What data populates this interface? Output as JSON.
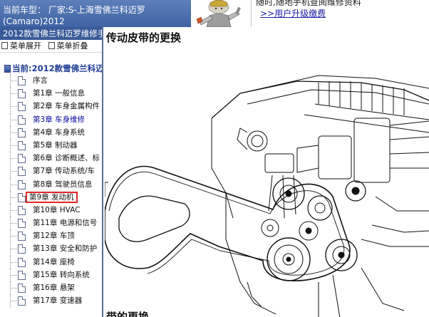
{
  "top_bar": {
    "car_info_line1": "当前车型： 厂家:S-上海雪佛兰科迈罗",
    "car_info_line2": "(Camaro)2012",
    "notice_line1": "随时,随地手机查阅维修资料",
    "notice_link": ">>用户升级缴费"
  },
  "sidebar": {
    "title": "2012款雪佛兰科迈罗维修手",
    "toolbar": {
      "expand_label": "菜单展开",
      "collapse_label": "菜单折叠"
    },
    "tree_root": "当前:2012款雪佛兰科迈",
    "items": [
      {
        "label": "序言"
      },
      {
        "label": "第1章 一般信息"
      },
      {
        "label": "第2章 车身金属构件"
      },
      {
        "label": "第3章 车身维修"
      },
      {
        "label": "第4章 车身系统"
      },
      {
        "label": "第5章 制动器"
      },
      {
        "label": "第6章 诊断概述、标"
      },
      {
        "label": "第7章 传动系统/车"
      },
      {
        "label": "第8章 驾驶员信息"
      },
      {
        "label": "第9章 发动机"
      },
      {
        "label": "第10章 HVAC"
      },
      {
        "label": "第11章 电源和信号"
      },
      {
        "label": "第12章 车顶"
      },
      {
        "label": "第13章 安全和防护"
      },
      {
        "label": "第14章 座椅"
      },
      {
        "label": "第15章 转向系统"
      },
      {
        "label": "第16章 悬架"
      },
      {
        "label": "第17章 变速器"
      }
    ]
  },
  "content": {
    "heading": "传动皮带的更换",
    "diagram_callout": "1",
    "subheading": "带的更换"
  }
}
